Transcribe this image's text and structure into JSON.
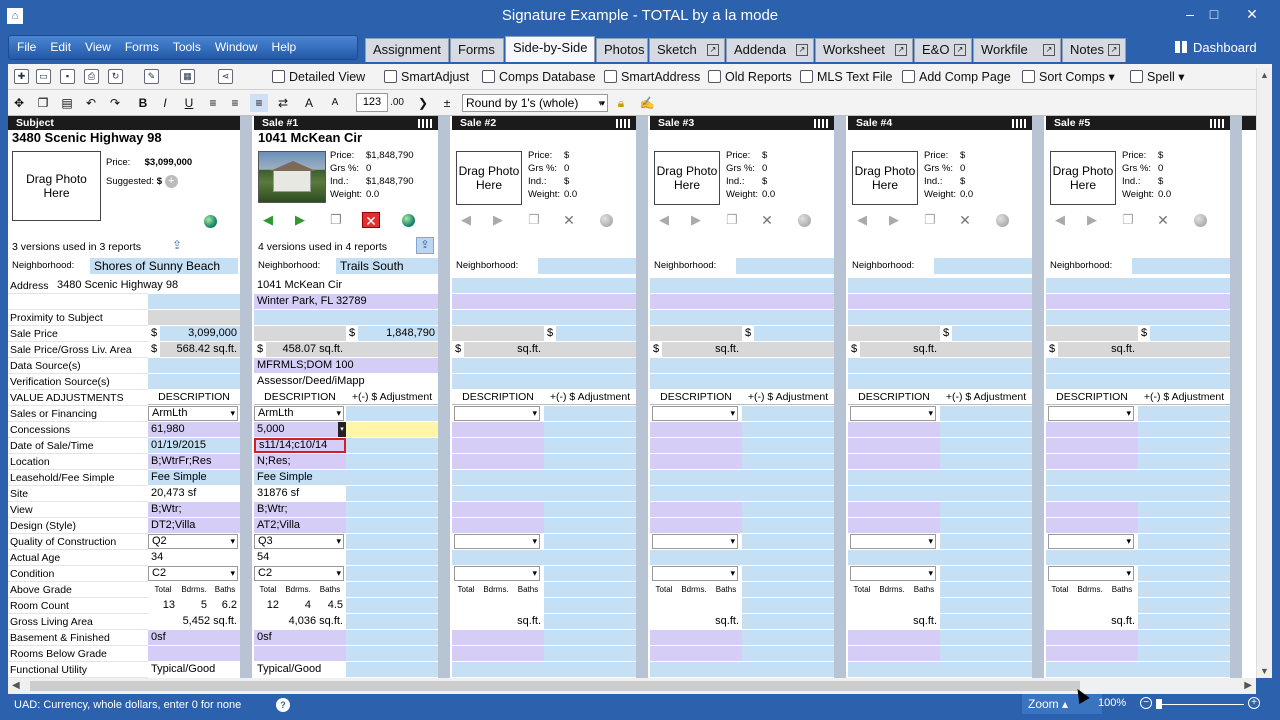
{
  "window": {
    "title": "Signature Example - TOTAL by a la mode",
    "minimize": "–",
    "maximize": "□",
    "close": "✕"
  },
  "menu": [
    "File",
    "Edit",
    "View",
    "Forms",
    "Tools",
    "Window",
    "Help"
  ],
  "tabs": [
    {
      "label": "Assignment",
      "active": false,
      "ext": false
    },
    {
      "label": "Forms",
      "active": false,
      "ext": false
    },
    {
      "label": "Side-by-Side",
      "active": true,
      "ext": false
    },
    {
      "label": "Photos",
      "active": false,
      "ext": false
    },
    {
      "label": "Sketch",
      "active": false,
      "ext": true
    },
    {
      "label": "Addenda",
      "active": false,
      "ext": true
    },
    {
      "label": "Worksheet",
      "active": false,
      "ext": true
    },
    {
      "label": "E&O",
      "active": false,
      "ext": true
    },
    {
      "label": "Workfile",
      "active": false,
      "ext": true
    },
    {
      "label": "Notes",
      "active": false,
      "ext": true
    }
  ],
  "dashboard": "Dashboard",
  "toolbar1": {
    "detailed_view": "Detailed View",
    "smartadjust": "SmartAdjust",
    "comps_database": "Comps Database",
    "smartaddress": "SmartAddress",
    "old_reports": "Old Reports",
    "mls_text_file": "MLS Text File",
    "add_comp_page": "Add Comp Page",
    "sort_comps": "Sort Comps",
    "spell": "Spell"
  },
  "toolbar2": {
    "field_value": "123",
    "round_by": "Round by 1's (whole)",
    "decimal": ".00"
  },
  "status": {
    "message": "UAD: Currency, whole dollars, enter 0 for none",
    "zoom_label": "Zoom",
    "zoom_pct": "100%"
  },
  "row_labels": [
    "Address",
    "",
    "Proximity to Subject",
    "Sale Price",
    "Sale Price/Gross Liv. Area",
    "Data Source(s)",
    "Verification Source(s)",
    "VALUE ADJUSTMENTS",
    "Sales or Financing",
    "Concessions",
    "Date of Sale/Time",
    "Location",
    "Leasehold/Fee Simple",
    "Site",
    "View",
    "Design (Style)",
    "Quality of Construction",
    "Actual Age",
    "Condition",
    "Above Grade",
    "Room Count",
    "Gross Living Area",
    "Basement & Finished",
    "Rooms Below Grade",
    "Functional Utility"
  ],
  "subject": {
    "header": "Subject",
    "address_title": "3480 Scenic Highway 98",
    "photo_text": "Drag Photo Here",
    "price_label": "Price:",
    "price": "$3,099,000",
    "suggested_label": "Suggested:",
    "suggested_value": "$",
    "versions": "3 versions used in 3 reports",
    "nbhd_label": "Neighborhood:",
    "neighborhood": "Shores of Sunny Beach",
    "address": "3480 Scenic Highway 98",
    "sale_price_sym": "$",
    "sale_price": "3,099,000",
    "price_gla_sym": "$",
    "price_gla": "568.42 sq.ft.",
    "desc_header": "DESCRIPTION",
    "sales_financing": "ArmLth",
    "concessions": "61,980",
    "date_sale": "01/19/2015",
    "location": "B;WtrFr;Res",
    "leasehold": "Fee Simple",
    "site": "20,473 sf",
    "view": "B;Wtr;",
    "design": "DT2;Villa",
    "quality": "Q2",
    "age": "34",
    "condition": "C2",
    "grade_total_lbl": "Total",
    "grade_bdrm_lbl": "Bdrms.",
    "grade_bath_lbl": "Baths",
    "rooms_total": "13",
    "rooms_bdrm": "5",
    "rooms_bath": "6.2",
    "gla": "5,452 sq.ft.",
    "basement": "0sf",
    "functional": "Typical/Good"
  },
  "sale1": {
    "header": "Sale #1",
    "address_title": "1041 McKean Cir",
    "price_lbl": "Price:",
    "price": "$1,848,790",
    "grs_lbl": "Grs %:",
    "grs": "0",
    "ind_lbl": "Ind.:",
    "ind": "$1,848,790",
    "wt_lbl": "Weight:",
    "wt": "0.0",
    "versions": "4 versions used in 4 reports",
    "nbhd_label": "Neighborhood:",
    "neighborhood": "Trails South",
    "addr1": "1041 McKean Cir",
    "addr2": "Winter Park, FL 32789",
    "sale_price_sym": "$",
    "sale_price": "1,848,790",
    "price_gla_sym": "$",
    "price_gla": "458.07 sq.ft.",
    "data_source": "MFRMLS;DOM 100",
    "verification": "Assessor/Deed/iMapp",
    "desc_header": "DESCRIPTION",
    "adj_header": "+(-) $ Adjustment",
    "sales_financing": "ArmLth",
    "concessions": "5,000",
    "date_sale": "s11/14;c10/14",
    "location": "N;Res;",
    "leasehold": "Fee Simple",
    "site": "31876 sf",
    "view": "B;Wtr;",
    "design": "AT2;Villa",
    "quality": "Q3",
    "age": "54",
    "condition": "C2",
    "grade_total_lbl": "Total",
    "grade_bdrm_lbl": "Bdrms.",
    "grade_bath_lbl": "Baths",
    "rooms_total": "12",
    "rooms_bdrm": "4",
    "rooms_bath": "4.5",
    "gla": "4,036 sq.ft.",
    "basement": "0sf",
    "functional": "Typical/Good"
  },
  "empty_sales": [
    {
      "header": "Sale #2"
    },
    {
      "header": "Sale #3"
    },
    {
      "header": "Sale #4"
    },
    {
      "header": "Sale #5"
    }
  ],
  "empty_sale_common": {
    "photo_text": "Drag Photo Here",
    "price_lbl": "Price:",
    "price": "$",
    "grs_lbl": "Grs %:",
    "grs": "0",
    "ind_lbl": "Ind.:",
    "ind": "$",
    "wt_lbl": "Weight:",
    "wt": "0.0",
    "nbhd_label": "Neighborhood:",
    "dollar": "$",
    "sqft": "sq.ft.",
    "desc_header": "DESCRIPTION",
    "adj_header": "+(-) $ Adjustment",
    "grade_total_lbl": "Total",
    "grade_bdrm_lbl": "Bdrms.",
    "grade_bath_lbl": "Baths"
  },
  "icons": {
    "app": "app-icon",
    "arrow_left": "green-left-arrow-icon",
    "arrow_right": "green-right-arrow-icon",
    "globe": "globe-icon",
    "delete": "delete-icon"
  }
}
